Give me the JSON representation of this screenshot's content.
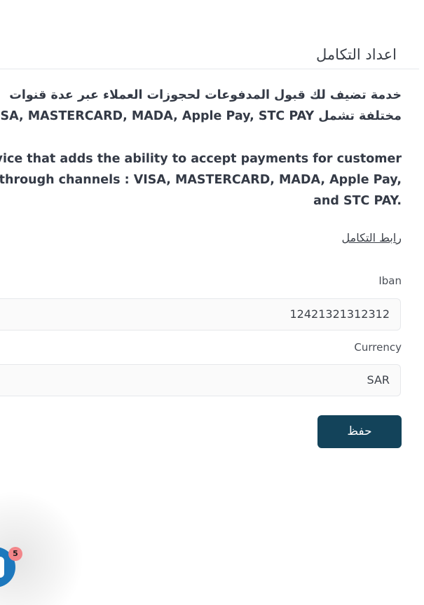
{
  "header": {
    "title": "اعداد التكامل"
  },
  "description": {
    "arabic_line1": "خدمة تضيف لك قبول المدفوعات لحجوزات العملاء عبر عدة قنوات",
    "arabic_line2": "مختلفة تشمل VISA, MASTERCARD, MADA, Apple Pay, STC PAY",
    "english_line1": "A service that adds the ability to accept payments for customer",
    "english_line2": "bookings through channels : VISA, MASTERCARD, MADA, Apple Pay,",
    "english_line3": "and STC PAY."
  },
  "integration_link": {
    "label": "رابط التكامل"
  },
  "form": {
    "iban": {
      "label": "Iban",
      "value": "12421321312312"
    },
    "currency": {
      "label": "Currency",
      "value": "SAR"
    },
    "save_label": "حفظ"
  },
  "chat": {
    "icon": "chat-bubble-icon",
    "badge_count": "5",
    "accent_color": "#1d78bd"
  },
  "colors": {
    "primary_button": "#13435a",
    "badge": "#f2868a"
  }
}
